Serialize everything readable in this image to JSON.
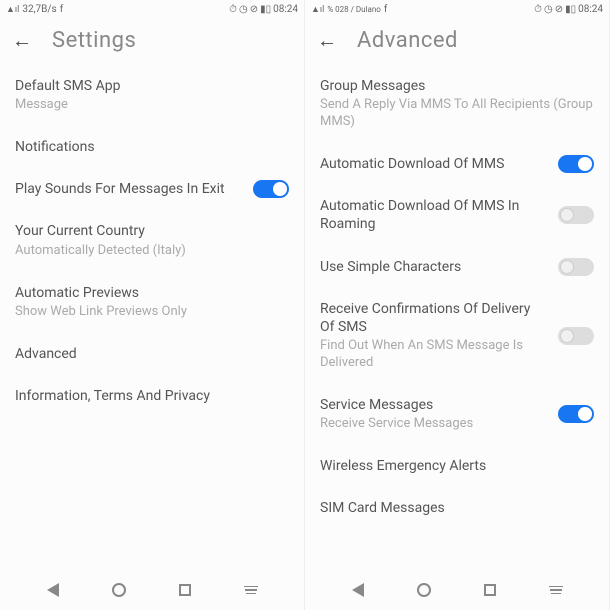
{
  "left": {
    "status": {
      "signal": "▲ıl",
      "speed": "32,7B/s",
      "facebook": "f",
      "alarm": "⏰",
      "clock": "◯",
      "dnd": "⊘",
      "battery": "▮▯",
      "time": "08:24"
    },
    "title": "Settings",
    "items": {
      "defaultSms": {
        "title": "Default SMS App",
        "subtitle": "Message"
      },
      "notifications": {
        "title": "Notifications"
      },
      "playSounds": {
        "title": "Play Sounds For Messages In Exit",
        "on": true
      },
      "country": {
        "title": "Your Current Country",
        "subtitle": "Automatically Detected (Italy)"
      },
      "previews": {
        "title": "Automatic Previews",
        "subtitle": "Show Web Link Previews Only"
      },
      "advanced": {
        "title": "Advanced"
      },
      "info": {
        "title": "Information, Terms And Privacy"
      }
    }
  },
  "right": {
    "status": {
      "signal": "▲ıl",
      "carrier": "% 028 / Dulano",
      "facebook": "f",
      "alarm": "⏰",
      "clock": "◯",
      "dnd": "⊘",
      "battery": "▮▯",
      "time": "08:24"
    },
    "title": "Advanced",
    "items": {
      "groupMessages": {
        "title": "Group Messages",
        "subtitle": "Send A Reply Via MMS To All Recipients (Group MMS)"
      },
      "autoDownload": {
        "title": "Automatic Download Of MMS",
        "on": true
      },
      "autoDownloadRoaming": {
        "title": "Automatic Download Of MMS In Roaming",
        "on": false
      },
      "simpleChars": {
        "title": "Use Simple Characters",
        "on": false
      },
      "deliveryConfirm": {
        "title": "Receive Confirmations Of Delivery Of SMS",
        "subtitle": "Find Out When An SMS Message Is Delivered",
        "on": false
      },
      "serviceMessages": {
        "title": "Service Messages",
        "subtitle": "Receive Service Messages",
        "on": true
      },
      "emergencyAlerts": {
        "title": "Wireless Emergency Alerts"
      },
      "simMessages": {
        "title": "SIM Card Messages"
      }
    }
  }
}
